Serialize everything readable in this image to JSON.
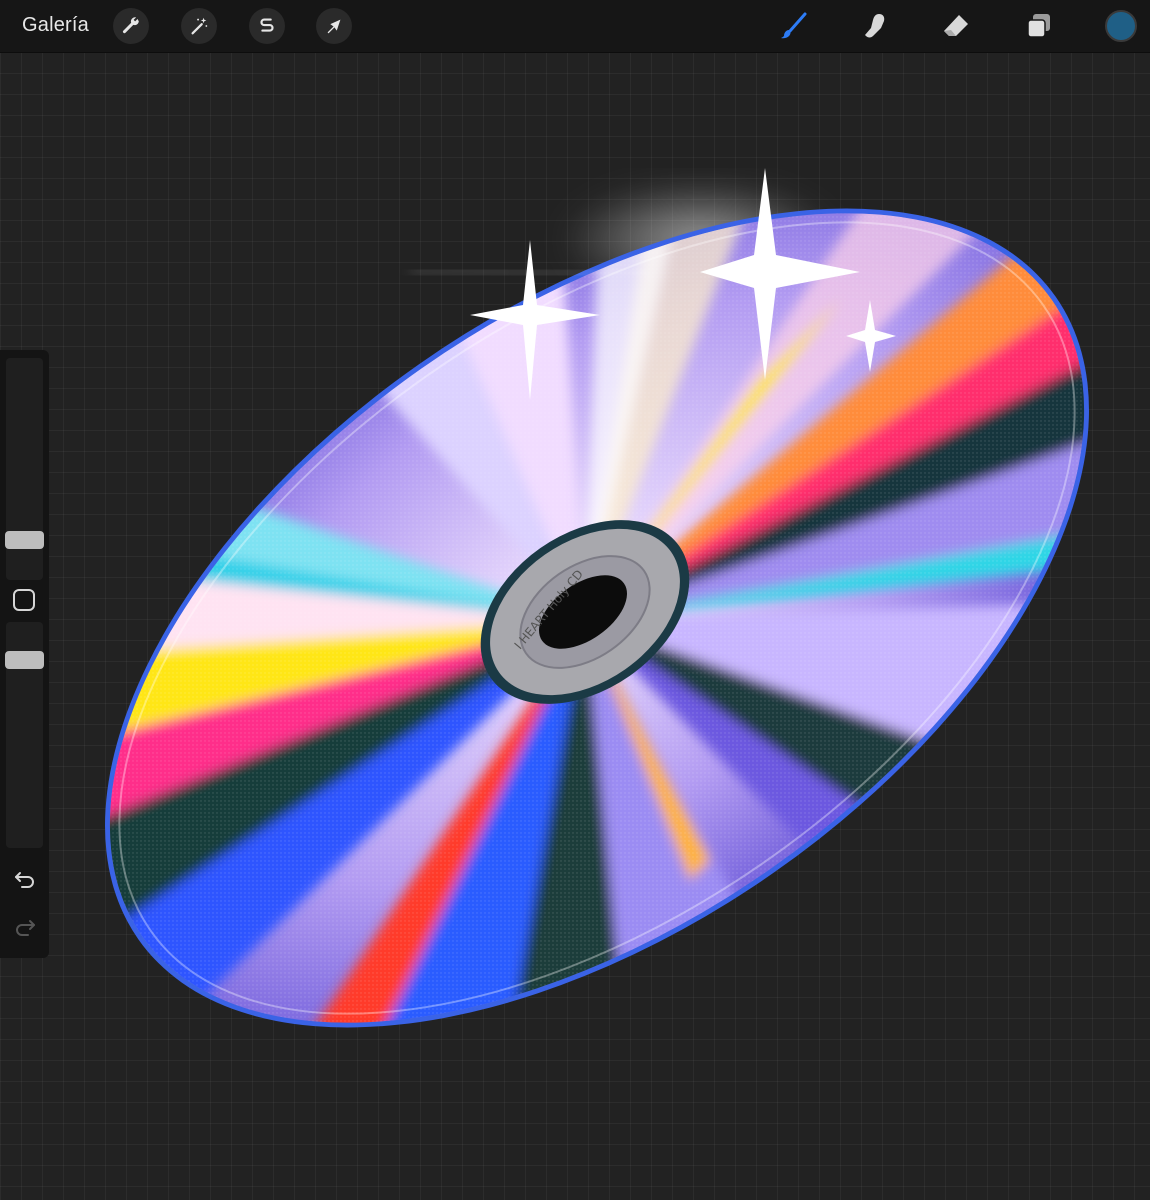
{
  "topbar": {
    "gallery_label": "Galería",
    "left_tools": [
      {
        "name": "actions",
        "icon": "wrench-icon"
      },
      {
        "name": "adjustments",
        "icon": "magic-wand-icon"
      },
      {
        "name": "selection",
        "icon": "selection-s-icon"
      },
      {
        "name": "transform",
        "icon": "arrow-cursor-icon"
      }
    ],
    "right_tools": [
      {
        "name": "brush",
        "icon": "brush-icon",
        "active": true
      },
      {
        "name": "smudge",
        "icon": "smudge-finger-icon",
        "active": false
      },
      {
        "name": "eraser",
        "icon": "eraser-icon",
        "active": false
      },
      {
        "name": "layers",
        "icon": "layers-icon",
        "active": false
      }
    ],
    "active_color": "#1f5f86",
    "accent": "#2d7cf6"
  },
  "sidebar": {
    "brush_size_level": 0.83,
    "opacity_level": 0.3,
    "icons": [
      "modify-square-icon",
      "undo-icon",
      "redo-icon"
    ]
  },
  "canvas": {
    "artwork": "iridescent-cd",
    "disc_ring_text": "I HEART Holy CD"
  }
}
